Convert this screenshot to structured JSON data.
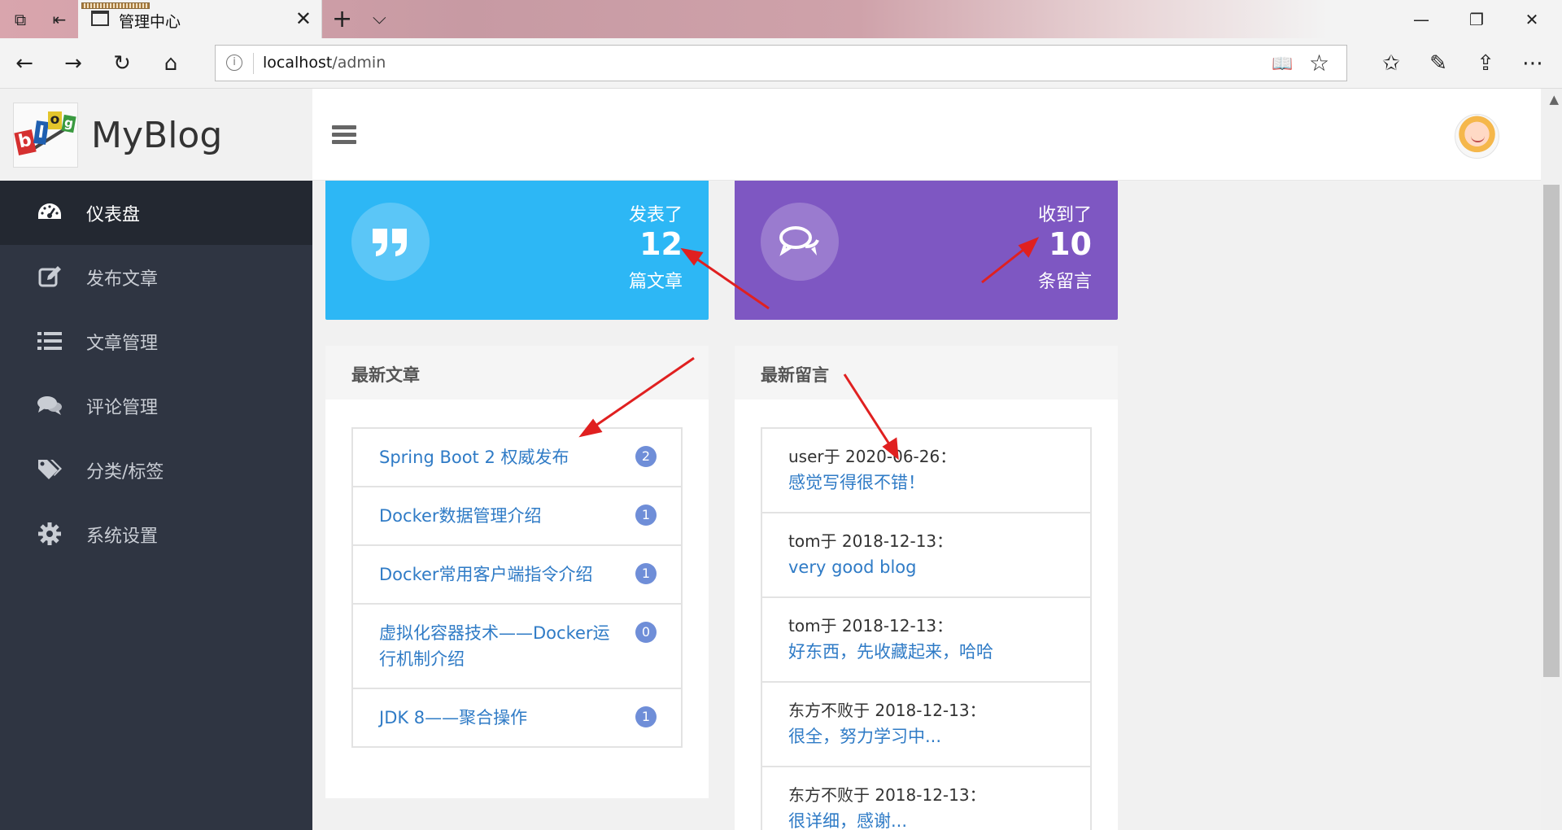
{
  "browser": {
    "tab_title": "管理中心",
    "url_host": "localhost",
    "url_path": "/admin"
  },
  "sidebar": {
    "brand": "MyBlog",
    "items": [
      {
        "label": "仪表盘",
        "icon": "dashboard-icon",
        "active": true
      },
      {
        "label": "发布文章",
        "icon": "edit-icon",
        "active": false
      },
      {
        "label": "文章管理",
        "icon": "list-icon",
        "active": false
      },
      {
        "label": "评论管理",
        "icon": "comments-icon",
        "active": false
      },
      {
        "label": "分类/标签",
        "icon": "tags-icon",
        "active": false
      },
      {
        "label": "系统设置",
        "icon": "gear-icon",
        "active": false
      }
    ]
  },
  "stats": {
    "articles": {
      "pre": "发表了",
      "count": "12",
      "post": "篇文章",
      "icon": "quote-icon",
      "color": "#2db7f5"
    },
    "comments": {
      "pre": "收到了",
      "count": "10",
      "post": "条留言",
      "icon": "speech-bubbles-icon",
      "color": "#7e57c2"
    }
  },
  "latest_articles": {
    "heading": "最新文章",
    "items": [
      {
        "title": "Spring Boot 2 权威发布",
        "count": "2"
      },
      {
        "title": "Docker数据管理介绍",
        "count": "1"
      },
      {
        "title": "Docker常用客户端指令介绍",
        "count": "1"
      },
      {
        "title": "虚拟化容器技术——Docker运行机制介绍",
        "count": "0"
      },
      {
        "title": "JDK 8——聚合操作",
        "count": "1"
      }
    ]
  },
  "latest_comments": {
    "heading": "最新留言",
    "items": [
      {
        "meta": "user于 2020-06-26：",
        "text": "感觉写得很不错！"
      },
      {
        "meta": "tom于 2018-12-13：",
        "text": "very good blog"
      },
      {
        "meta": "tom于 2018-12-13：",
        "text": "好东西，先收藏起来，哈哈"
      },
      {
        "meta": "东方不败于 2018-12-13：",
        "text": "很全，努力学习中..."
      },
      {
        "meta": "东方不败于 2018-12-13：",
        "text": "很详细，感谢..."
      }
    ]
  }
}
